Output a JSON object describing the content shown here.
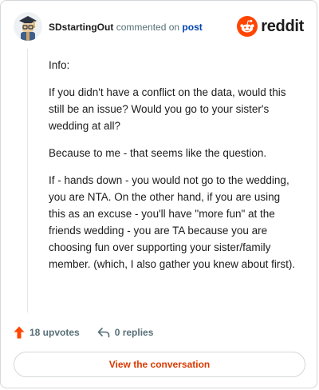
{
  "header": {
    "username": "SDstartingOut",
    "action_text": "commented on",
    "post_link": "post",
    "brand_name": "reddit"
  },
  "comment": {
    "paragraphs": [
      "Info:",
      "If you didn't have a conflict on the data, would this still be an issue? Would you go to your sister's wedding at all?",
      "Because to me - that seems like the question.",
      "If - hands down - you would not go to the wedding, you are NTA. On the other hand, if you are using this as an excuse - you'll have \"more fun\" at the friends wedding - you are TA because you are choosing fun over supporting your sister/family member. (which, I also gather you knew about first)."
    ]
  },
  "actions": {
    "upvotes": "18 upvotes",
    "replies": "0 replies"
  },
  "footer": {
    "view_button": "View the conversation"
  },
  "colors": {
    "brand": "#ff4500",
    "link": "#0045ac",
    "button_text": "#d93a00"
  }
}
